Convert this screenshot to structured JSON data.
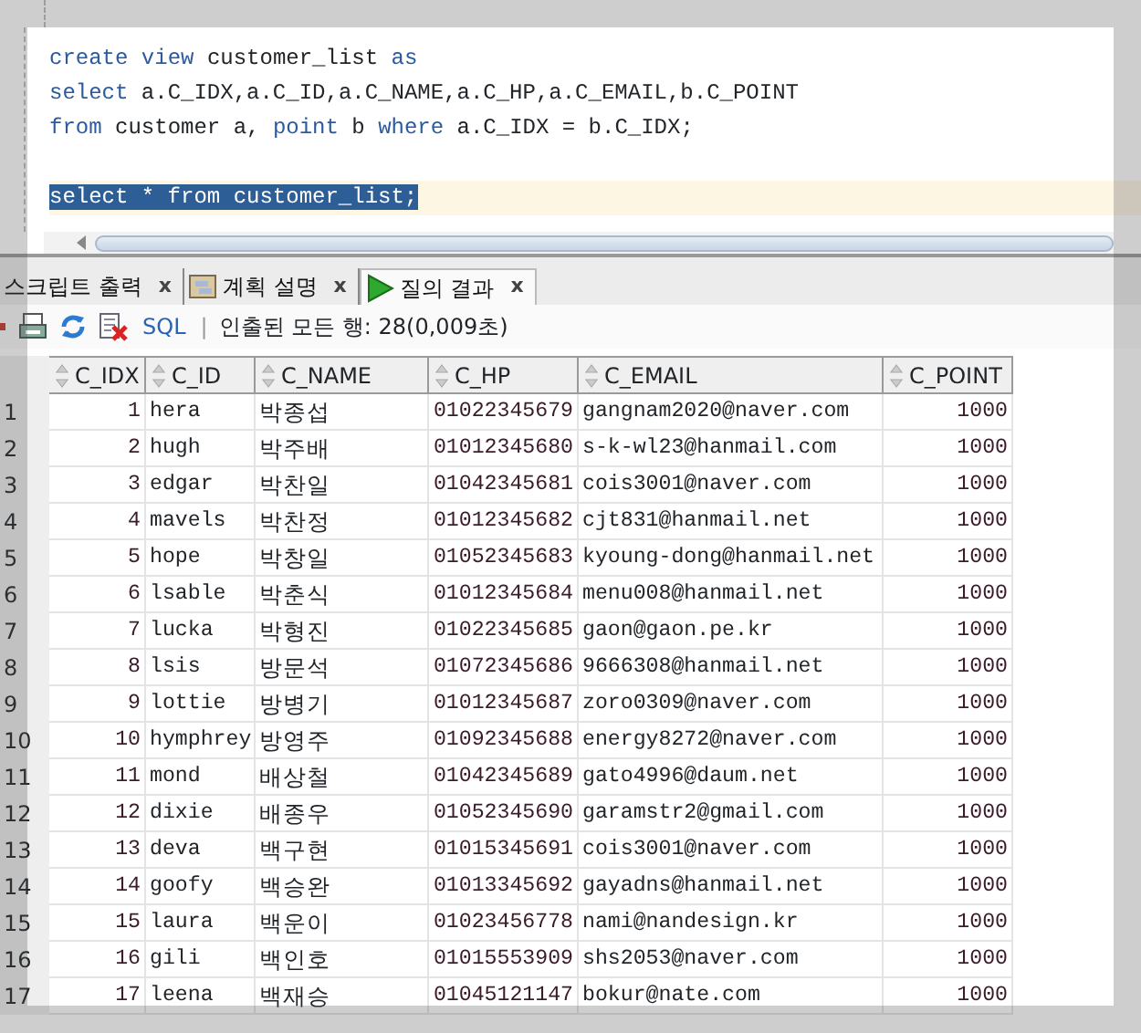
{
  "editor": {
    "lines": [
      {
        "kind": "code",
        "current": false,
        "tokens": [
          {
            "text": "create",
            "kind": "keyword"
          },
          {
            "text": "view",
            "kind": "keyword"
          },
          {
            "text": "customer_list",
            "kind": "plain"
          },
          {
            "text": "as",
            "kind": "keyword"
          }
        ]
      },
      {
        "kind": "code",
        "current": false,
        "tokens": [
          {
            "text": "select",
            "kind": "keyword"
          },
          {
            "text": "a.C_IDX,a.C_ID,a.C_NAME,a.C_HP,a.C_EMAIL,b.C_POINT",
            "kind": "plain"
          }
        ]
      },
      {
        "kind": "code",
        "current": false,
        "tokens": [
          {
            "text": "from",
            "kind": "keyword"
          },
          {
            "text": "customer a,",
            "kind": "plain"
          },
          {
            "text": "point",
            "kind": "keyword"
          },
          {
            "text": "b",
            "kind": "plain"
          },
          {
            "text": "where",
            "kind": "keyword"
          },
          {
            "text": "a.C_IDX = b.C_IDX;",
            "kind": "plain"
          }
        ]
      },
      {
        "kind": "blank",
        "current": false
      },
      {
        "kind": "code",
        "current": true,
        "tokens": [
          {
            "text": "select * from customer_list;",
            "kind": "selection"
          }
        ]
      }
    ]
  },
  "tabs": [
    {
      "label": "스크립트 출력",
      "close": "x",
      "selected": false
    },
    {
      "label": "계획 설명",
      "close": "x",
      "selected": false
    },
    {
      "label": "질의 결과",
      "close": "x",
      "selected": true
    }
  ],
  "toolbar": {
    "sql": "SQL",
    "separator": "|",
    "status": "인출된 모든 행: 28(0,009초)"
  },
  "table": {
    "columns": [
      "",
      "C_IDX",
      "C_ID",
      "C_NAME",
      "C_HP",
      "C_EMAIL",
      "C_POINT"
    ],
    "rows": [
      [
        "1",
        "1",
        "hera",
        "박종섭",
        "01022345679",
        "gangnam2020@naver.com",
        "1000"
      ],
      [
        "2",
        "2",
        "hugh",
        "박주배",
        "01012345680",
        "s-k-wl23@hanmail.com",
        "1000"
      ],
      [
        "3",
        "3",
        "edgar",
        "박찬일",
        "01042345681",
        "cois3001@naver.com",
        "1000"
      ],
      [
        "4",
        "4",
        "mavels",
        "박찬정",
        "01012345682",
        "cjt831@hanmail.net",
        "1000"
      ],
      [
        "5",
        "5",
        "hope",
        "박창일",
        "01052345683",
        "kyoung-dong@hanmail.net",
        "1000"
      ],
      [
        "6",
        "6",
        "lsable",
        "박춘식",
        "01012345684",
        "menu008@hanmail.net",
        "1000"
      ],
      [
        "7",
        "7",
        "lucka",
        "박형진",
        "01022345685",
        "gaon@gaon.pe.kr",
        "1000"
      ],
      [
        "8",
        "8",
        "lsis",
        "방문석",
        "01072345686",
        "9666308@hanmail.net",
        "1000"
      ],
      [
        "9",
        "9",
        "lottie",
        "방병기",
        "01012345687",
        "zoro0309@naver.com",
        "1000"
      ],
      [
        "10",
        "10",
        "hymphrey",
        "방영주",
        "01092345688",
        "energy8272@naver.com",
        "1000"
      ],
      [
        "11",
        "11",
        "mond",
        "배상철",
        "01042345689",
        "gato4996@daum.net",
        "1000"
      ],
      [
        "12",
        "12",
        "dixie",
        "배종우",
        "01052345690",
        "garamstr2@gmail.com",
        "1000"
      ],
      [
        "13",
        "13",
        "deva",
        "백구현",
        "01015345691",
        "cois3001@naver.com",
        "1000"
      ],
      [
        "14",
        "14",
        "goofy",
        "백승완",
        "01013345692",
        "gayadns@hanmail.net",
        "1000"
      ],
      [
        "15",
        "15",
        "laura",
        "백운이",
        "01023456778",
        "nami@nandesign.kr",
        "1000"
      ],
      [
        "16",
        "16",
        "gili",
        "백인호",
        "01015553909",
        "shs2053@naver.com",
        "1000"
      ],
      [
        "17",
        "17",
        "leena",
        "백재승",
        "01045121147",
        "bokur@nate.com",
        "1000"
      ]
    ]
  }
}
